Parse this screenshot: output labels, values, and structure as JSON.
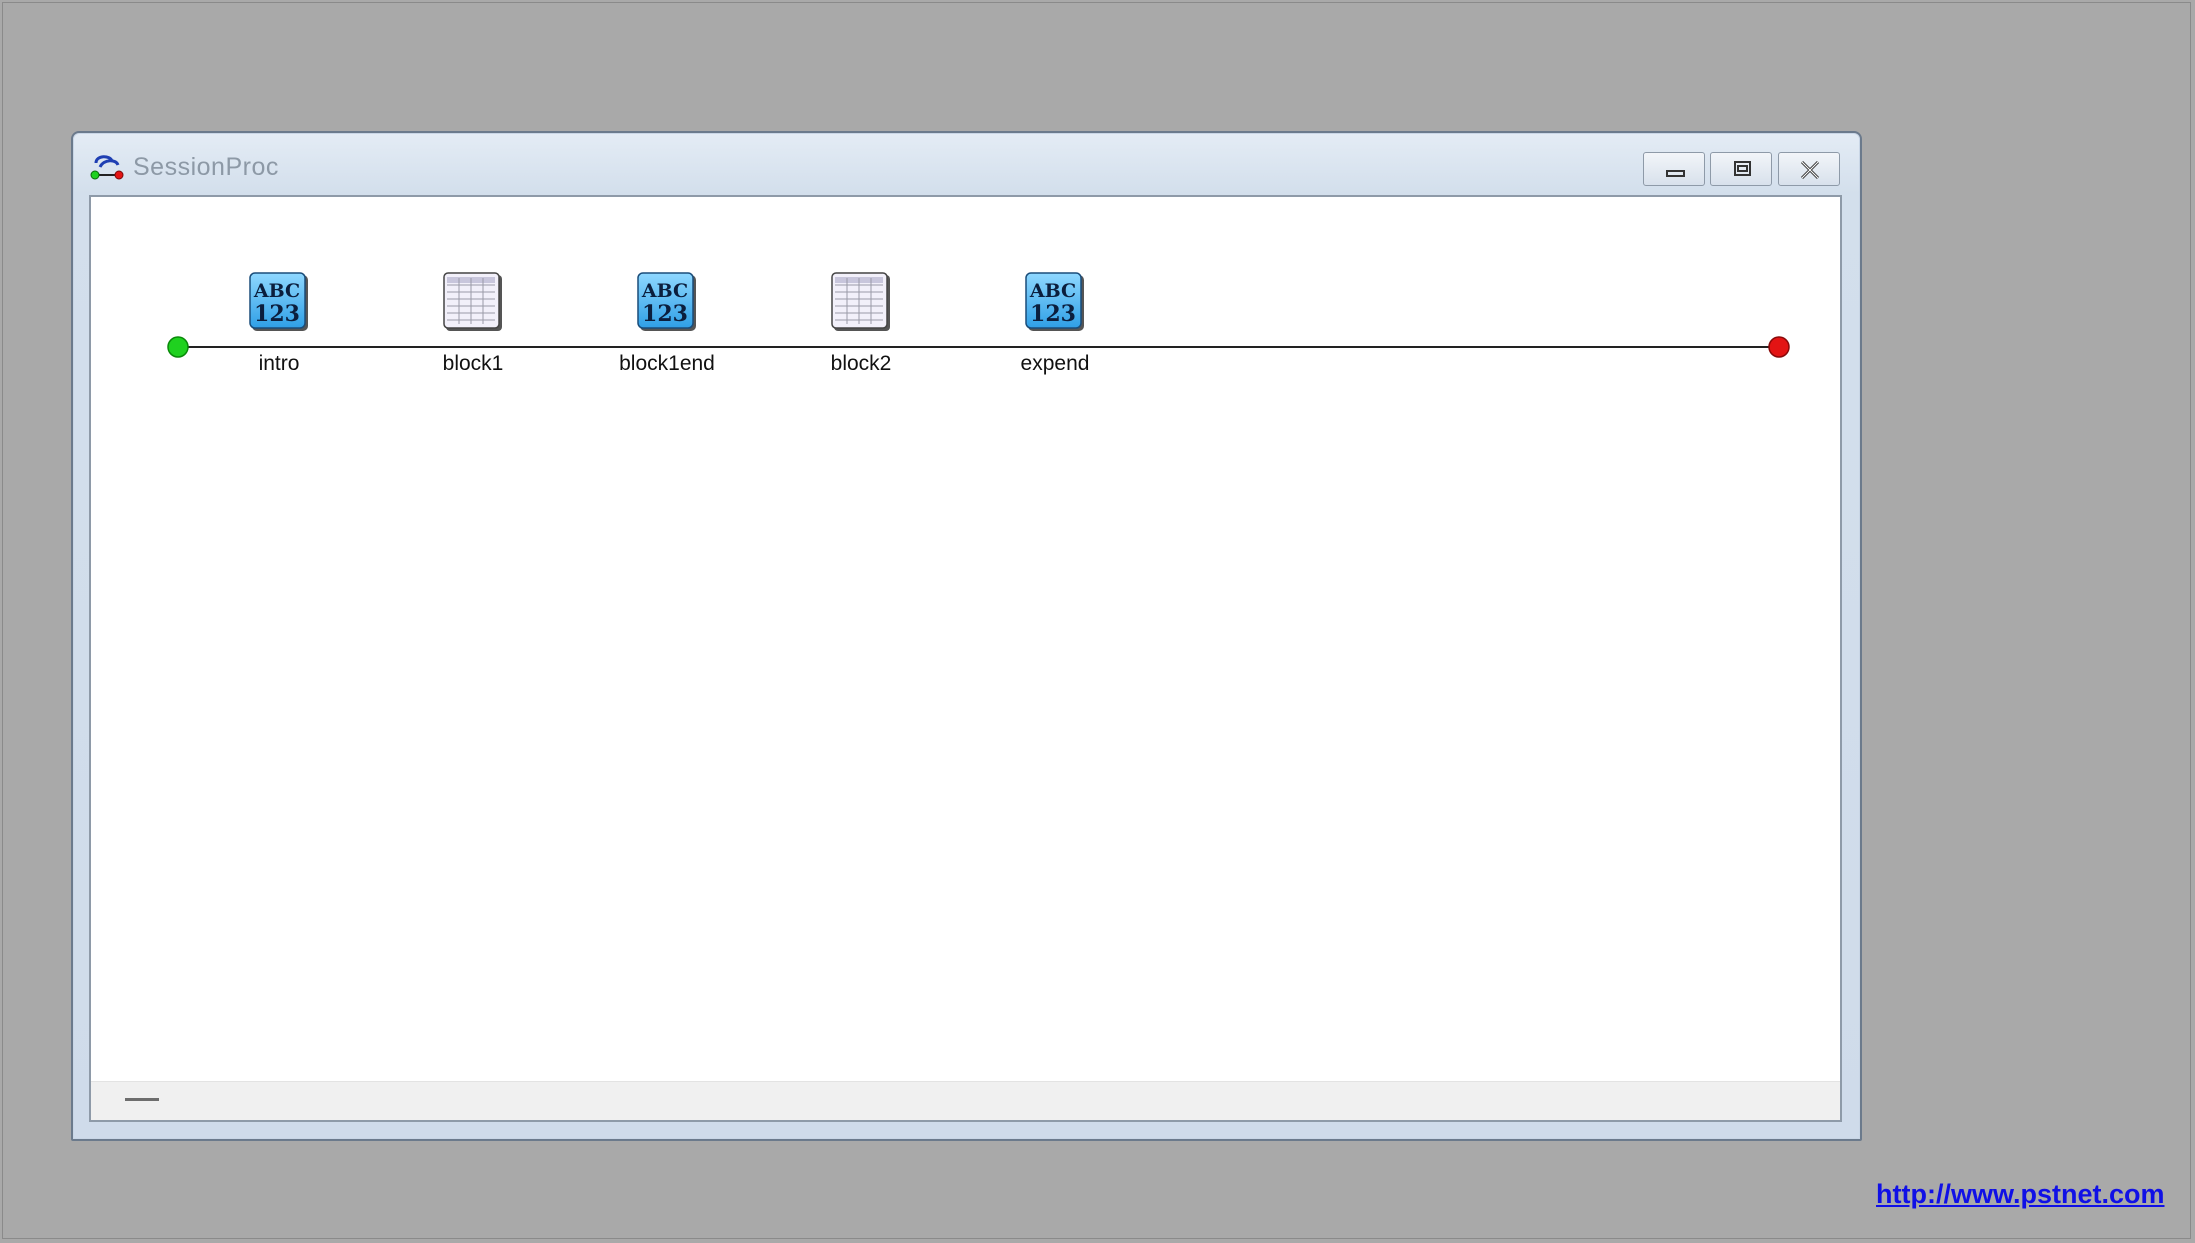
{
  "window": {
    "title": "SessionProc",
    "buttons": {
      "minimize": "minimize",
      "restore": "restore",
      "close": "close"
    }
  },
  "procedure": {
    "start_color": "#1fd11f",
    "end_color": "#e31414",
    "nodes": [
      {
        "label": "intro",
        "icon": "text-object-icon"
      },
      {
        "label": "block1",
        "icon": "list-object-icon"
      },
      {
        "label": "block1end",
        "icon": "text-object-icon"
      },
      {
        "label": "block2",
        "icon": "list-object-icon"
      },
      {
        "label": "expend",
        "icon": "text-object-icon"
      }
    ]
  },
  "icon_text": {
    "top": "ABC",
    "bottom": "123"
  },
  "footer": {
    "url": "http://www.pstnet.com"
  }
}
